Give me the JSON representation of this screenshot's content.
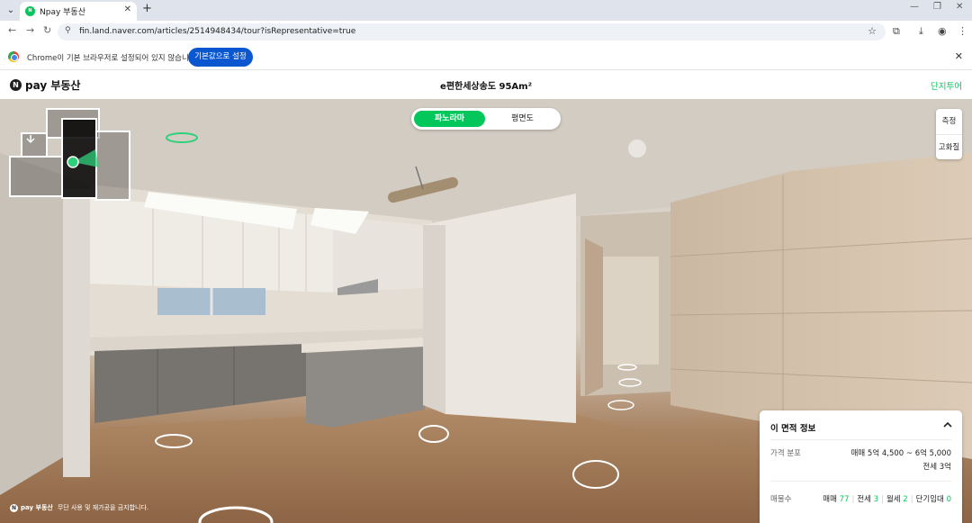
{
  "browser": {
    "tab_title": "Npay 부동산",
    "favicon_text": "N",
    "url": "fin.land.naver.com/articles/2514948434/tour?isRepresentative=true"
  },
  "infobar": {
    "message": "Chrome이 기본 브라우저로 설정되어 있지 않습니다",
    "button_label": "기본값으로 설정"
  },
  "header": {
    "logo_mark": "N",
    "logo_text": "pay 부동산",
    "title": "e편한세상송도 95Am²",
    "complex_tour_label": "단지투어"
  },
  "viewer": {
    "view_tabs": [
      {
        "label": "파노라마",
        "active": true
      },
      {
        "label": "평면도",
        "active": false
      }
    ],
    "tools": [
      {
        "label": "측정"
      },
      {
        "label": "고화질"
      }
    ],
    "watermark": {
      "mark": "N",
      "brand": "pay 부동산",
      "text": "무단 사용 및 재가공을 금지합니다."
    }
  },
  "info_panel": {
    "title": "이 면적 정보",
    "price_label": "가격 분포",
    "price_sale": "매매 5억 4,500 ~ 6억 5,000",
    "price_jeonse": "전세 3억",
    "listings_label": "매물수",
    "listings": [
      {
        "type": "매매",
        "count": "77"
      },
      {
        "type": "전세",
        "count": "3"
      },
      {
        "type": "월세",
        "count": "2"
      },
      {
        "type": "단기임대",
        "count": "0"
      }
    ]
  },
  "colors": {
    "brand_green": "#03c75a",
    "chrome_blue": "#0b57d0"
  }
}
